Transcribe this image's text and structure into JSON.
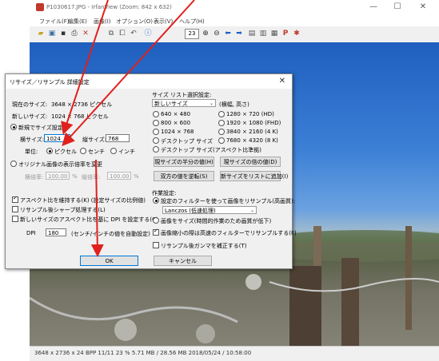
{
  "window": {
    "title": "P1030617.JPG - IrfanView (Zoom: 842 x 632)",
    "minimize": "—",
    "maximize": "☐",
    "close": "✕"
  },
  "menu": [
    "ファイル(F)",
    "編集(E)",
    "画像(I)",
    "オプション(O)",
    "表示(V)",
    "ヘルプ(H)"
  ],
  "toolbar": {
    "page_value": "23"
  },
  "status": "3648 x 2736 x 24 BPP   11/11   23 %   5.71 MB / 28.56 MB   2018/05/24 / 10:58:00",
  "dialog": {
    "title": "リサイズ／リサンプル 詳細設定",
    "close": "✕",
    "current_size_label": "現在のサイズ:",
    "current_size_value": "3648 × 2736 ピクセル",
    "new_size_label": "新しいサイズ:",
    "new_size_value": "1024 × 768 ピクセル",
    "set_new_size": "新規でサイズ設定",
    "width_label": "横サイズ:",
    "width_value": "1024",
    "height_label": "縦サイズ:",
    "height_value": "768",
    "unit_label": "単位:",
    "unit_pixel": "ピクセル",
    "unit_cm": "センチ",
    "unit_inch": "インチ",
    "ratio_radio": "オリジナル画像の表示倍率を変更",
    "h_ratio_label": "横倍率:",
    "h_ratio_value": "100.00",
    "percent": "%",
    "v_ratio_label": "縦倍率:",
    "v_ratio_value": "100.00",
    "keep_aspect": "アスペクト比を維持する(K)  (設定サイズの比例値)",
    "sharpen": "リサンプル後シャープ処理する(L)",
    "dpi_by_aspect": "新しいサイズのアスペクト比を基に DPI を設定する(C)",
    "dpi_label": "DPI",
    "dpi_value": "180",
    "dpi_note": "(センチ/インチの値を自動設定)",
    "preset_title": "サイズ リスト選択設定:",
    "preset_select": "新しいサイズ",
    "preset_suffix": "(横幅, 高さ)",
    "presets_left": [
      "640 × 480",
      "800 × 600",
      "1024 × 768",
      "デスクトップ サイズ",
      "デスクトップ サイズ(アスペクト比準拠)"
    ],
    "presets_right": [
      "1280 × 720  (HD)",
      "1920 × 1080 (FHD)",
      "3840 × 2160 (4 K)",
      "7680 × 4320 (8 K)"
    ],
    "btn_half": "現サイズの半分の値(H)",
    "btn_double": "現サイズの倍の値(D)",
    "btn_swap": "双方の値を逆転(S)",
    "btn_add_list": "新サイズをリストに追加(I)",
    "work_title": "作業設定:",
    "resample_radio": "設定のフィルターを使って画像をリサンプル(高画質):",
    "filter_value": "Lanczos (低速処理)",
    "resize_radio": "画像をサイズ(時間的作業のため画質が低下)",
    "fast_filter": "画像縮小の際は高速のフィルターでリサンプルする(F)",
    "gamma": "リサンプル後ガンマを補正する(T)",
    "ok": "OK",
    "cancel": "キャンセル"
  },
  "colors": {
    "arrow": "#e0201c",
    "accent": "#0078d7"
  }
}
